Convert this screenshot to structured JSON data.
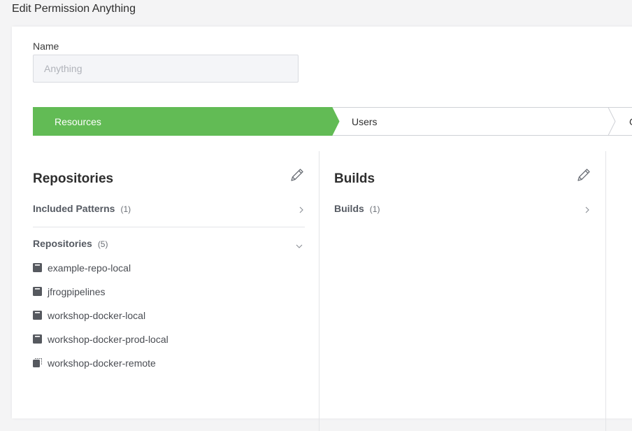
{
  "page": {
    "title": "Edit Permission Anything"
  },
  "form": {
    "name_label": "Name",
    "name_placeholder": "Anything"
  },
  "wizard": {
    "steps": [
      {
        "label": "Resources",
        "active": true
      },
      {
        "label": "Users",
        "active": false
      },
      {
        "label": "G",
        "active": false
      }
    ],
    "active_color": "#62bb55"
  },
  "repositories_panel": {
    "title": "Repositories",
    "included_patterns": {
      "label": "Included Patterns",
      "count": "(1)"
    },
    "repositories": {
      "label": "Repositories",
      "count": "(5)"
    },
    "items": [
      {
        "name": "example-repo-local",
        "icon": "local-repo-icon"
      },
      {
        "name": "jfrogpipelines",
        "icon": "local-repo-icon"
      },
      {
        "name": "workshop-docker-local",
        "icon": "local-repo-icon"
      },
      {
        "name": "workshop-docker-prod-local",
        "icon": "local-repo-icon"
      },
      {
        "name": "workshop-docker-remote",
        "icon": "remote-repo-icon"
      }
    ]
  },
  "builds_panel": {
    "title": "Builds",
    "builds": {
      "label": "Builds",
      "count": "(1)"
    }
  }
}
